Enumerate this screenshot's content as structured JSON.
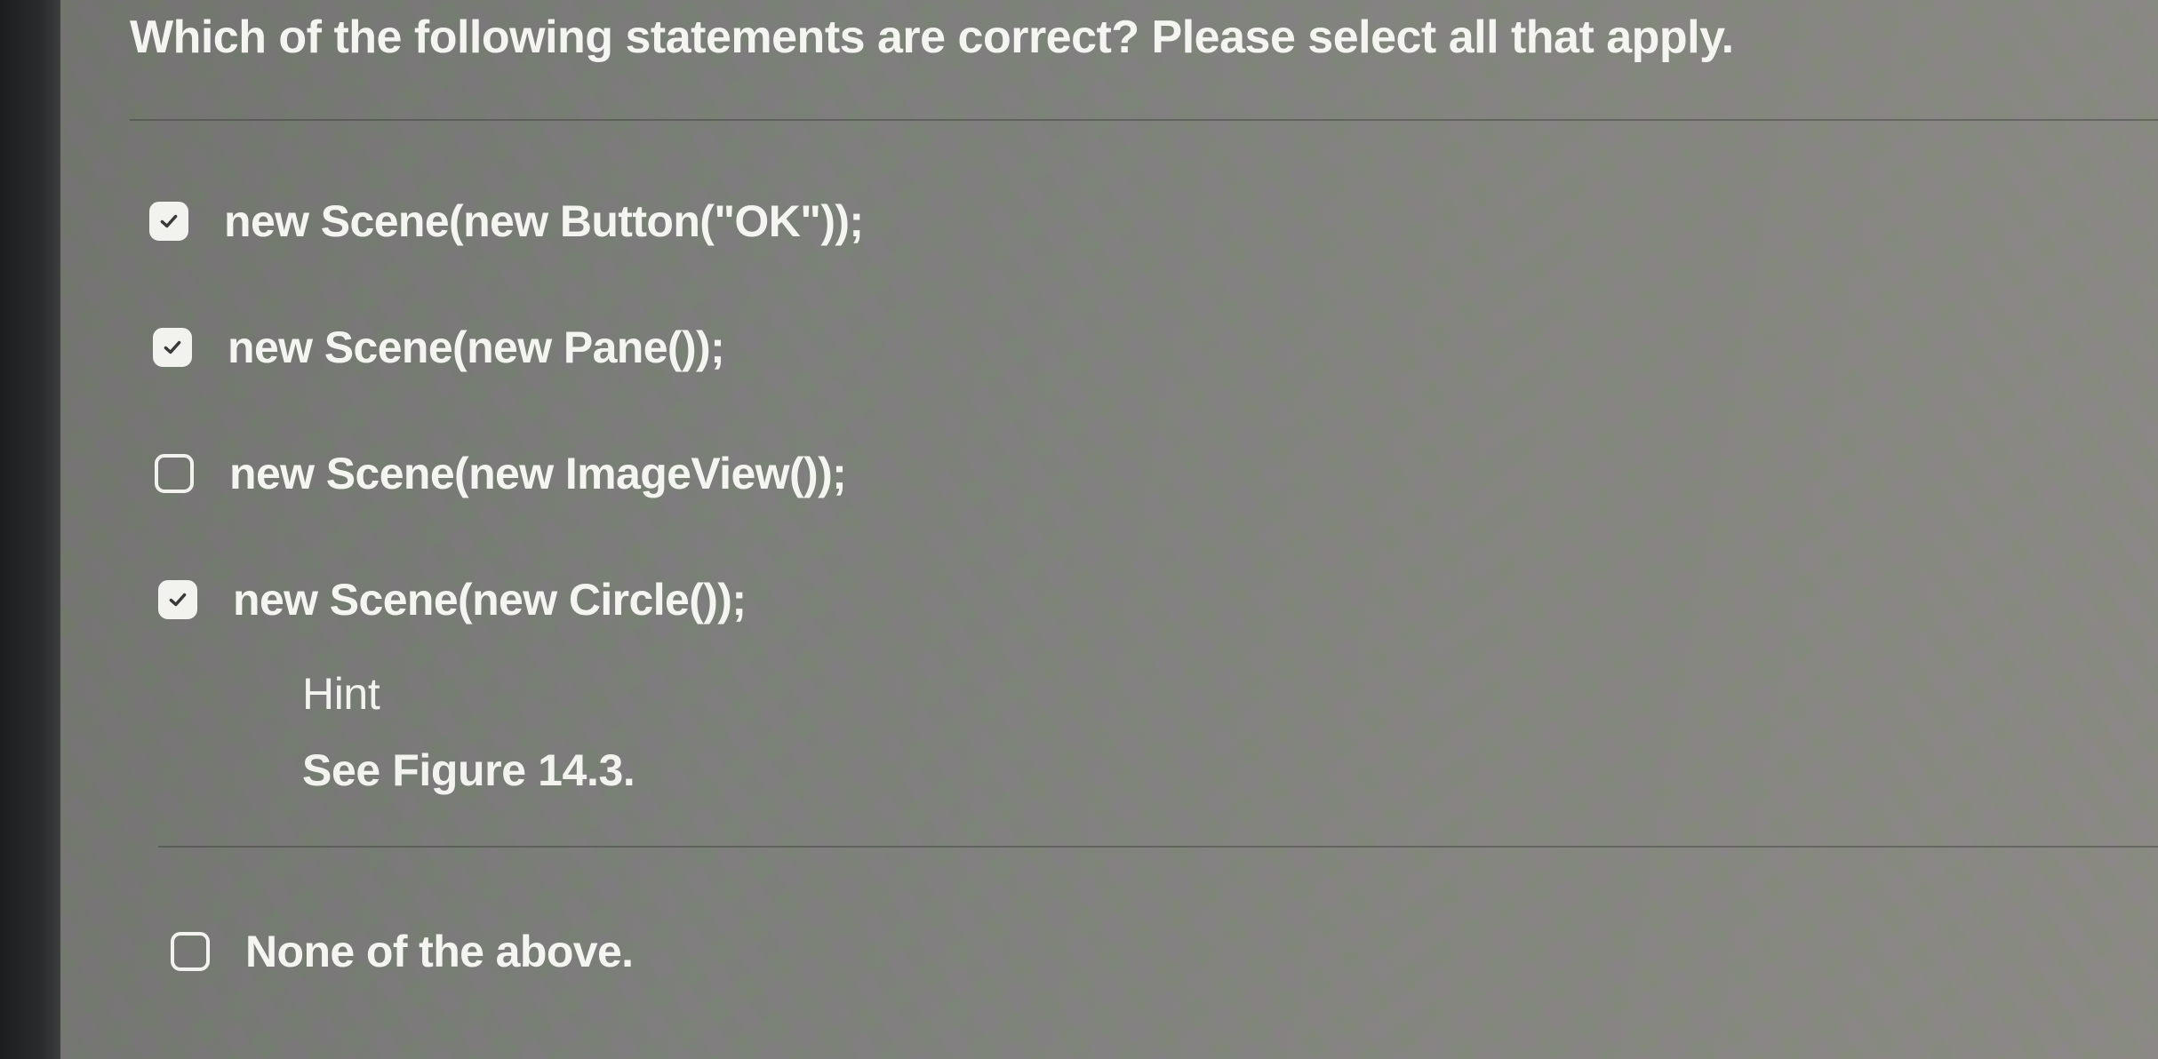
{
  "question": "Which of the following statements are correct? Please select all that apply.",
  "options": [
    {
      "label": "new Scene(new Button(\"OK\"));",
      "checked": true
    },
    {
      "label": "new Scene(new Pane());",
      "checked": true
    },
    {
      "label": "new Scene(new ImageView());",
      "checked": false
    },
    {
      "label": "new Scene(new Circle());",
      "checked": true
    }
  ],
  "hint": {
    "title": "Hint",
    "text": "See Figure 14.3."
  },
  "none_option": {
    "label": "None of the above.",
    "checked": false
  },
  "colors": {
    "text": "#f4f4f0",
    "checkbox": "#f2f2ee",
    "checkmark": "#3a3b38"
  }
}
